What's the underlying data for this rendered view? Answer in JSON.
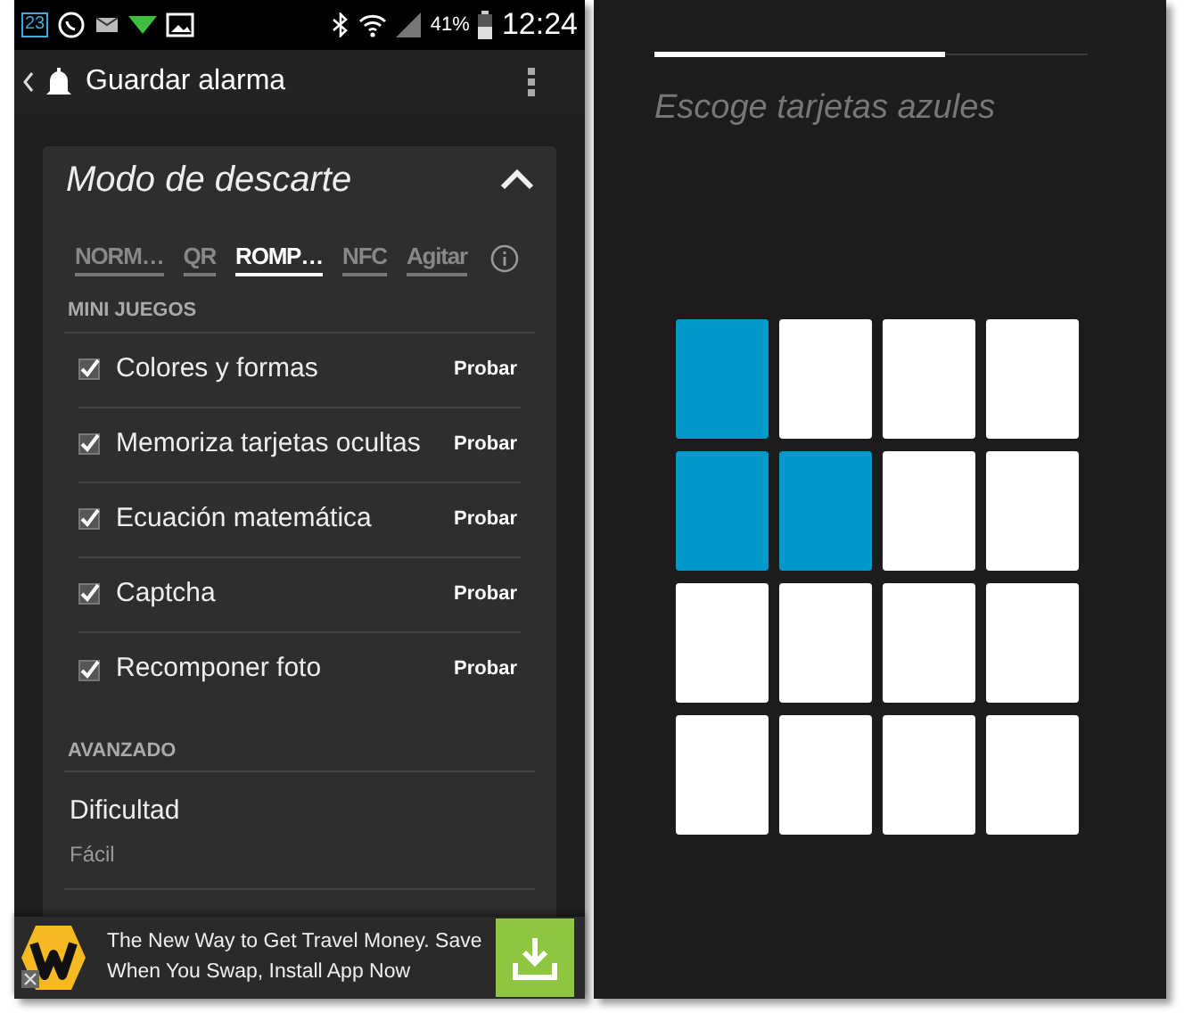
{
  "status_bar": {
    "calendar_day": "23",
    "battery": "41%",
    "time": "12:24"
  },
  "app_bar": {
    "title": "Guardar alarma"
  },
  "card": {
    "title": "Modo de descarte",
    "expanded": true,
    "tabs": [
      {
        "label": "NORM…",
        "selected": false
      },
      {
        "label": "QR",
        "selected": false
      },
      {
        "label": "ROMP…",
        "selected": true
      },
      {
        "label": "NFC",
        "selected": false
      },
      {
        "label": "Agitar",
        "selected": false
      }
    ],
    "mini_games_header": "MINI JUEGOS",
    "games": [
      {
        "label": "Colores y formas",
        "checked": true,
        "action": "Probar"
      },
      {
        "label": "Memoriza tarjetas ocultas",
        "checked": true,
        "action": "Probar"
      },
      {
        "label": "Ecuación matemática",
        "checked": true,
        "action": "Probar"
      },
      {
        "label": "Captcha",
        "checked": true,
        "action": "Probar"
      },
      {
        "label": "Recomponer foto",
        "checked": true,
        "action": "Probar"
      }
    ],
    "advanced_header": "AVANZADO",
    "difficulty": {
      "label": "Dificultad",
      "value": "Fácil"
    }
  },
  "ad": {
    "text": "The New Way to Get Travel Money. Save When You Swap, Install App Now"
  },
  "game": {
    "progress": {
      "level": 0.67
    },
    "prompt": "Escoge tarjetas azules",
    "cards": [
      {
        "selected": true
      },
      {
        "selected": false
      },
      {
        "selected": false
      },
      {
        "selected": false
      },
      {
        "selected": true
      },
      {
        "selected": true
      },
      {
        "selected": false
      },
      {
        "selected": false
      },
      {
        "selected": false
      },
      {
        "selected": false
      },
      {
        "selected": false
      },
      {
        "selected": false
      },
      {
        "selected": false
      },
      {
        "selected": false
      },
      {
        "selected": false
      },
      {
        "selected": false
      }
    ]
  }
}
